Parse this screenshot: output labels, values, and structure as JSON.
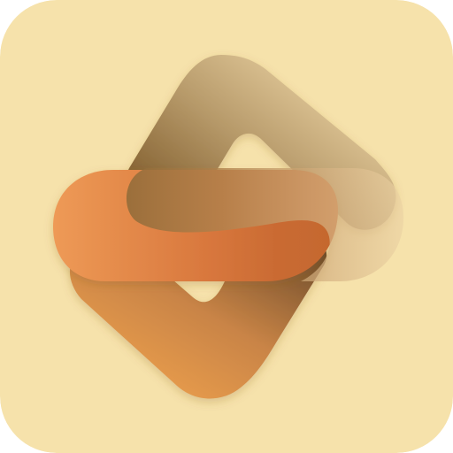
{
  "app_icon": {
    "icon_name": "stylized-s-logo-icon",
    "colors": {
      "background": "#F6E2AB",
      "accent_orange": "#E58B45",
      "accent_burnt": "#C96530",
      "accent_tan": "#D9B47E",
      "accent_brown": "#7B5A33"
    }
  }
}
